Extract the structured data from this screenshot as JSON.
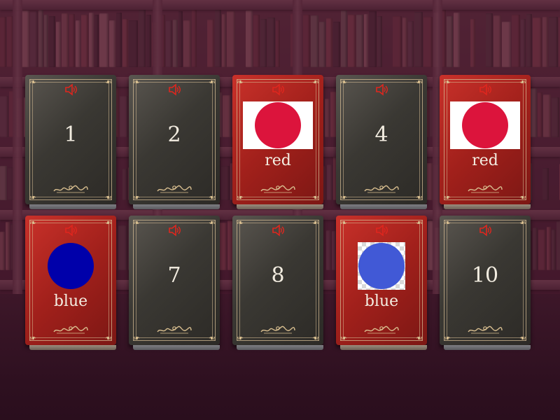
{
  "game": {
    "cards": [
      {
        "number": "1",
        "state": "closed"
      },
      {
        "number": "2",
        "state": "closed"
      },
      {
        "word": "red",
        "state": "open",
        "fill": "#dc143c",
        "bg": "white"
      },
      {
        "number": "4",
        "state": "closed"
      },
      {
        "word": "red",
        "state": "open",
        "fill": "#dc143c",
        "bg": "white"
      },
      {
        "word": "blue",
        "state": "open",
        "fill": "#0000aa",
        "bg": "none"
      },
      {
        "number": "7",
        "state": "closed"
      },
      {
        "number": "8",
        "state": "closed"
      },
      {
        "word": "blue",
        "state": "open",
        "fill": "#4159d6",
        "bg": "checker"
      },
      {
        "number": "10",
        "state": "closed"
      }
    ]
  },
  "icons": {
    "speaker": "speaker-icon",
    "ornament": "flourish-ornament",
    "corner": "corner-ornament"
  },
  "colors": {
    "closed_card": "#3a3833",
    "open_card": "#a1201b",
    "speaker_red": "#e0261e",
    "frame_gold": "#d7be96"
  }
}
